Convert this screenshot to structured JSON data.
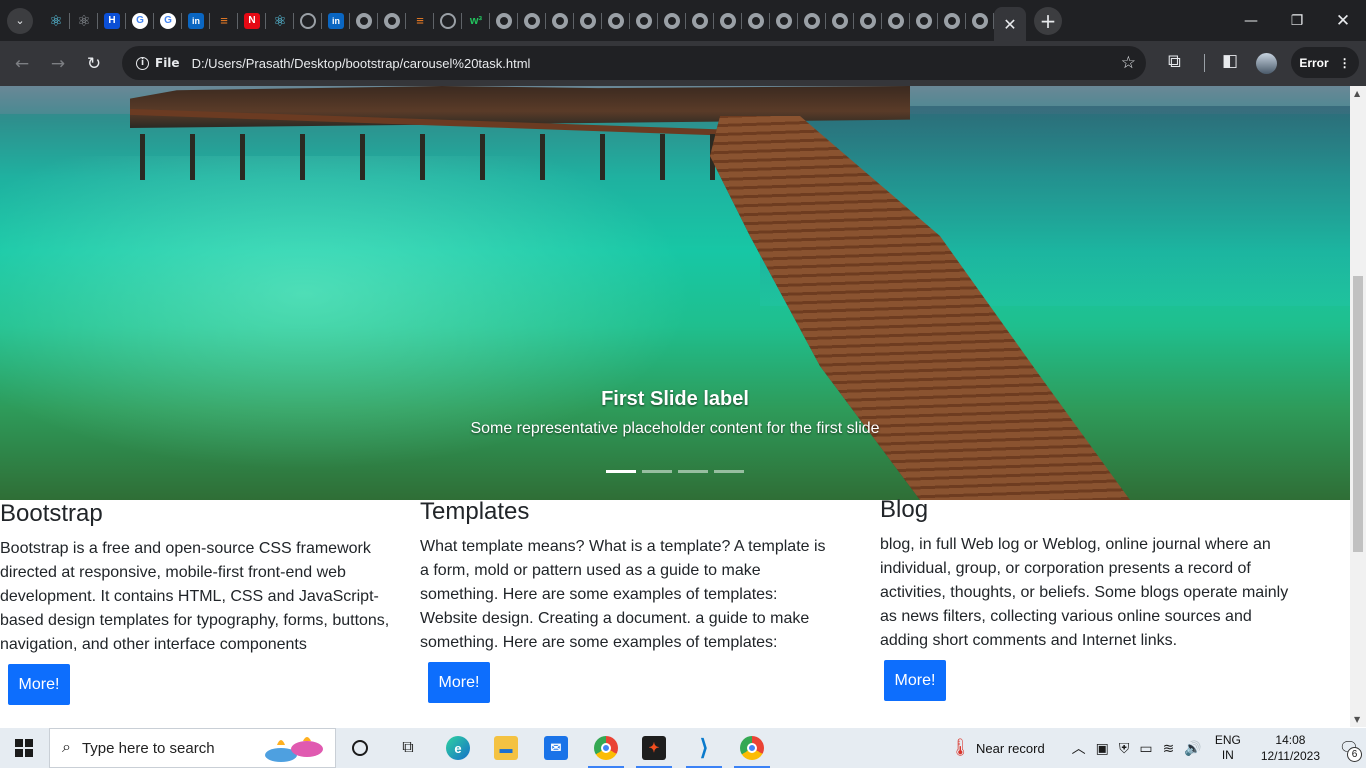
{
  "browser": {
    "tabs": [
      {
        "icon": "react-icon"
      },
      {
        "icon": "react-icon-grey"
      },
      {
        "icon": "hackerrank-icon"
      },
      {
        "icon": "google-icon"
      },
      {
        "icon": "google-icon"
      },
      {
        "icon": "linkedin-icon"
      },
      {
        "icon": "stackoverflow-icon"
      },
      {
        "icon": "netflix-icon"
      },
      {
        "icon": "react-icon"
      },
      {
        "icon": "github-icon"
      },
      {
        "icon": "linkedin-icon"
      },
      {
        "icon": "globe-icon"
      },
      {
        "icon": "globe-icon"
      },
      {
        "icon": "stackoverflow-icon"
      },
      {
        "icon": "github-icon"
      },
      {
        "icon": "w3schools-icon"
      },
      {
        "icon": "globe-icon"
      },
      {
        "icon": "globe-icon"
      },
      {
        "icon": "globe-icon"
      },
      {
        "icon": "globe-icon"
      },
      {
        "icon": "globe-icon"
      },
      {
        "icon": "globe-icon"
      },
      {
        "icon": "globe-icon"
      },
      {
        "icon": "globe-icon"
      },
      {
        "icon": "globe-icon"
      },
      {
        "icon": "globe-icon"
      },
      {
        "icon": "globe-icon"
      },
      {
        "icon": "globe-icon"
      },
      {
        "icon": "globe-icon"
      },
      {
        "icon": "globe-icon"
      },
      {
        "icon": "globe-icon"
      },
      {
        "icon": "globe-icon"
      },
      {
        "icon": "globe-icon"
      },
      {
        "icon": "globe-icon"
      }
    ],
    "site_label": "File",
    "url": "D:/Users/Prasath/Desktop/bootstrap/carousel%20task.html",
    "error_label": "Error"
  },
  "carousel": {
    "slide_title": "First Slide label",
    "slide_text": "Some representative placeholder content for the first slide",
    "slide_count": 4,
    "active_index": 0
  },
  "columns": [
    {
      "title": "Bootstrap",
      "text": "Bootstrap is a free and open-source CSS framework directed at responsive, mobile-first front-end web development. It contains HTML, CSS and JavaScript-based design templates for typography, forms, buttons, navigation, and other interface components",
      "button": "More!"
    },
    {
      "title": "Templates",
      "text": "What template means? What is a template? A template is a form, mold or pattern used as a guide to make something. Here are some examples of templates: Website design. Creating a document. a guide to make something. Here are some examples of templates:",
      "button": "More!"
    },
    {
      "title": "Blog",
      "text": "blog, in full Web log or Weblog, online journal where an individual, group, or corporation presents a record of activities, thoughts, or beliefs. Some blogs operate mainly as news filters, collecting various online sources and adding short comments and Internet links.",
      "button": "More!"
    }
  ],
  "taskbar": {
    "search_placeholder": "Type here to search",
    "weather": "Near record",
    "lang_top": "ENG",
    "lang_bottom": "IN",
    "time": "14:08",
    "date": "12/11/2023",
    "notification_count": "6"
  },
  "colors": {
    "accent": "#0d6efd",
    "browser_frame": "#202124",
    "toolbar": "#35363a"
  }
}
